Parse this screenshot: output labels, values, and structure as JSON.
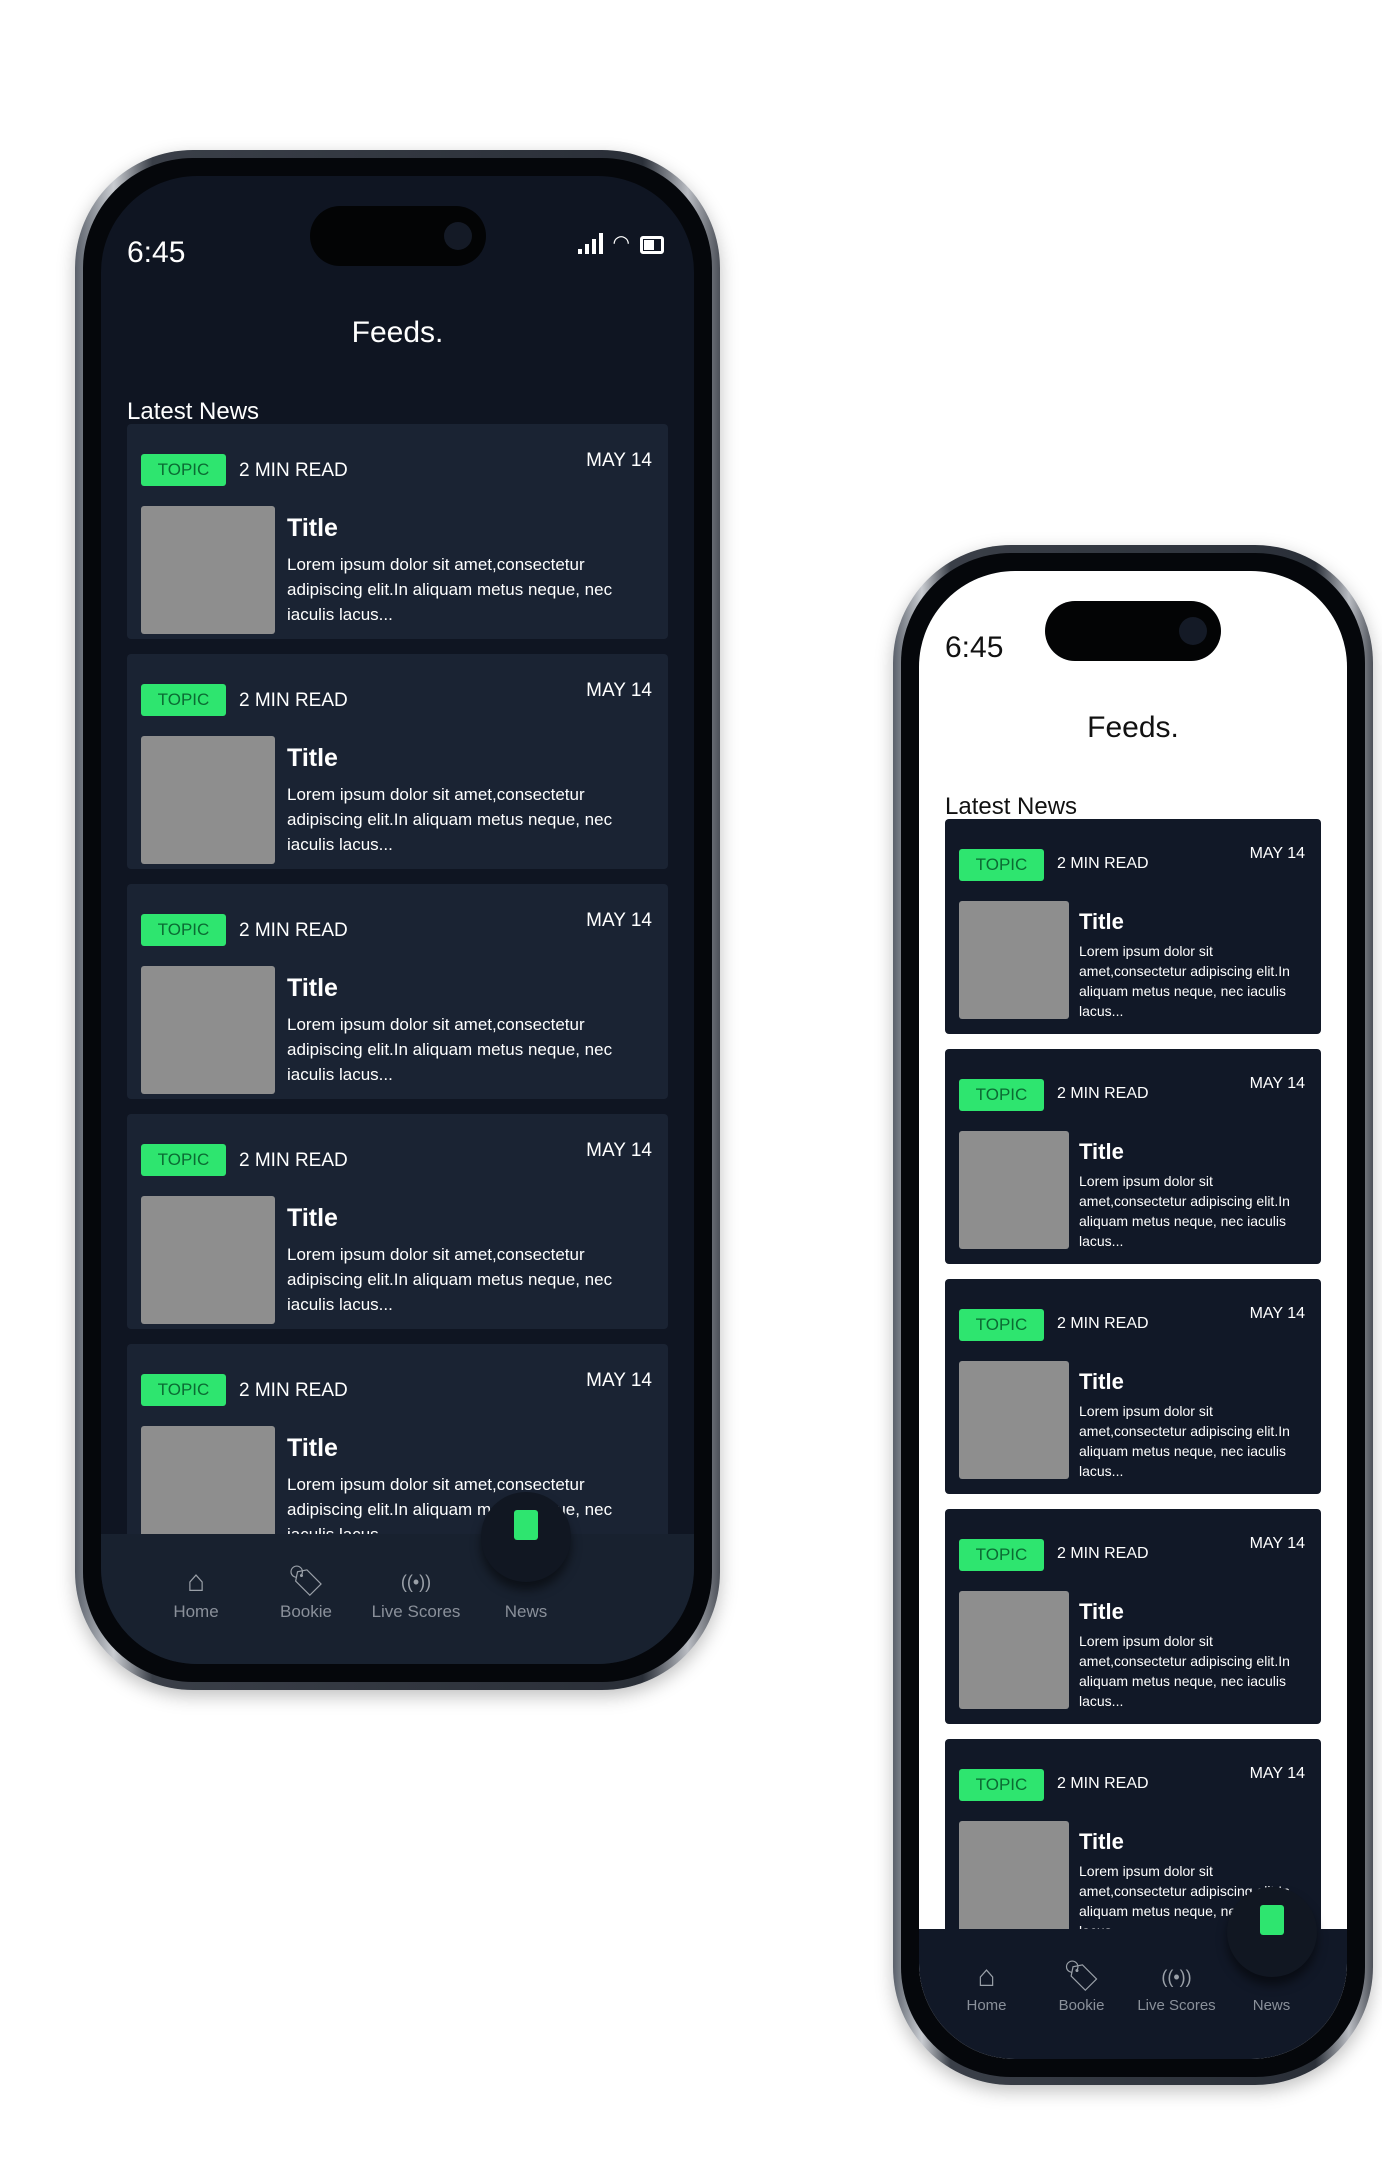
{
  "status": {
    "time": "6:45"
  },
  "header": {
    "title": "Feeds."
  },
  "section_title": "Latest News",
  "accent_color": "#2ee56f",
  "cards": [
    {
      "topic": "TOPIC",
      "read_time": "2 MIN READ",
      "date": "MAY 14",
      "title": "Title",
      "body": "Lorem ipsum dolor sit amet,consectetur adipiscing  elit.In aliquam metus neque, nec iaculis lacus..."
    },
    {
      "topic": "TOPIC",
      "read_time": "2 MIN READ",
      "date": "MAY 14",
      "title": "Title",
      "body": "Lorem ipsum dolor sit amet,consectetur adipiscing  elit.In aliquam metus neque, nec iaculis lacus..."
    },
    {
      "topic": "TOPIC",
      "read_time": "2 MIN READ",
      "date": "MAY 14",
      "title": "Title",
      "body": "Lorem ipsum dolor sit amet,consectetur adipiscing  elit.In aliquam metus neque, nec iaculis lacus..."
    },
    {
      "topic": "TOPIC",
      "read_time": "2 MIN READ",
      "date": "MAY 14",
      "title": "Title",
      "body": "Lorem ipsum dolor sit amet,consectetur adipiscing  elit.In aliquam metus neque, nec iaculis lacus..."
    },
    {
      "topic": "TOPIC",
      "read_time": "2 MIN READ",
      "date": "MAY 14",
      "title": "Title",
      "body": "Lorem ipsum dolor sit amet,consectetur adipiscing  elit.In aliquam metus neque, nec iaculis lacus..."
    }
  ],
  "nav": [
    {
      "label": "Home",
      "icon": "home-icon"
    },
    {
      "label": "Bookie",
      "icon": "tag-icon"
    },
    {
      "label": "Live Scores",
      "icon": "broadcast-icon"
    },
    {
      "label": "News",
      "icon": "news-document-icon",
      "active": true
    }
  ],
  "phones": [
    {
      "theme": "dark"
    },
    {
      "theme": "light"
    }
  ]
}
